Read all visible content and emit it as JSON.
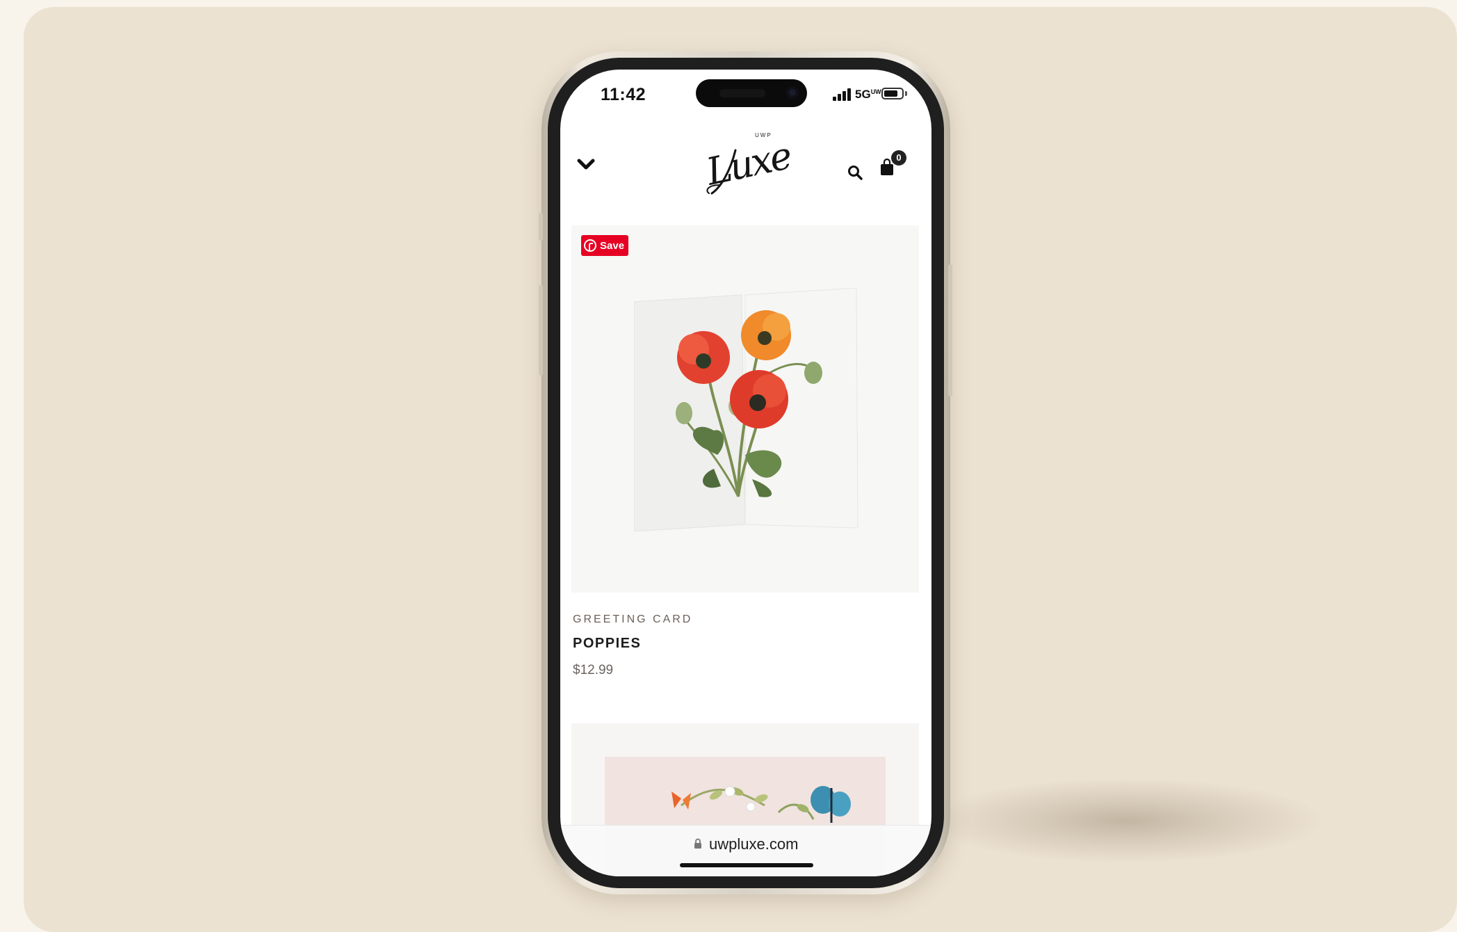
{
  "status_bar": {
    "time": "11:42",
    "network": "5G",
    "network_suffix": "UW",
    "battery_level": 0.8
  },
  "header": {
    "logo_top": "UWP",
    "logo_word": "Luxe",
    "cart_count": "0",
    "icons": [
      "chevron-down-icon",
      "search-icon",
      "shopping-bag-icon"
    ]
  },
  "product": {
    "pin_button": "Save",
    "type": "GREETING CARD",
    "name": "POPPIES",
    "price": "$12.99"
  },
  "browser": {
    "url": "uwpluxe.com"
  },
  "colors": {
    "pinterest_red": "#e60023",
    "backdrop": "#ece2d2",
    "poppy_red": "#e2412f",
    "poppy_orange": "#f08a2a"
  }
}
